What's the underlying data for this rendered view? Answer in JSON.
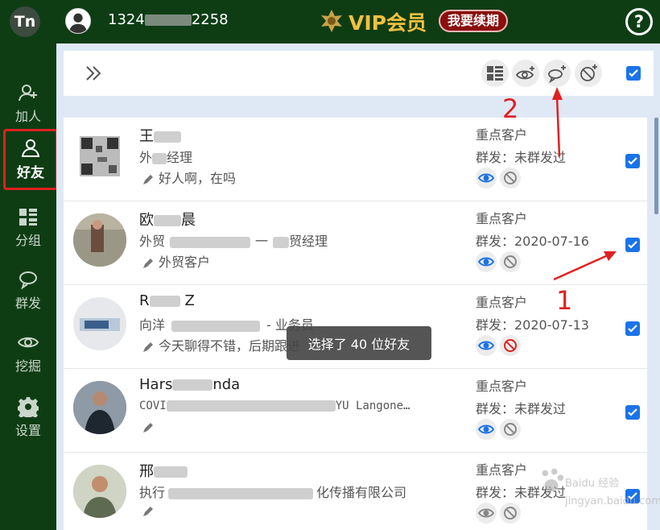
{
  "app": {
    "logo_text": "Tn"
  },
  "sidebar": {
    "items": [
      {
        "label": "加人",
        "icon": "add-user-icon",
        "active": false
      },
      {
        "label": "好友",
        "icon": "friends-icon",
        "active": true
      },
      {
        "label": "分组",
        "icon": "grid-icon",
        "active": false
      },
      {
        "label": "群发",
        "icon": "chat-bubble-icon",
        "active": false
      },
      {
        "label": "挖掘",
        "icon": "eye-icon",
        "active": false
      },
      {
        "label": "设置",
        "icon": "gear-icon",
        "active": false
      }
    ]
  },
  "header": {
    "phone_prefix": "1324",
    "phone_suffix": "2258",
    "vip_label": "VIP会员",
    "renew_label": "我要续期",
    "help_label": "?"
  },
  "toolbar": {
    "icons": [
      "expand-icon",
      "grid-view-icon",
      "add-watch-icon",
      "add-group-send-icon",
      "add-block-icon"
    ],
    "select_all_checked": true
  },
  "friends": [
    {
      "name": "王",
      "title_prefix": "外",
      "title_suffix": "经理",
      "note": "好人啊，在吗",
      "tag": "重点客户",
      "status": "群发：未群发过",
      "checked": true,
      "blocked": false
    },
    {
      "name_prefix": "欧",
      "name_suffix": "晨",
      "title_prefix": "外贸",
      "title_mid": "一",
      "title_suffix": "贸经理",
      "note": "外贸客户",
      "tag": "重点客户",
      "status": "群发：2020-07-16",
      "checked": true,
      "blocked": false
    },
    {
      "name_prefix": "R",
      "name_suffix": "Z",
      "title_prefix": "向洋",
      "title_suffix": "- 业务员",
      "note": "今天聊得不错，后期跟进",
      "tag": "重点客户",
      "status": "群发：2020-07-13",
      "checked": true,
      "blocked": true
    },
    {
      "name_prefix": "Hars",
      "name_suffix": "nda",
      "title_prefix": "COVI",
      "title_suffix": "YU Langone…",
      "note": "",
      "tag": "重点客户",
      "status": "群发：未群发过",
      "checked": true,
      "blocked": false
    },
    {
      "name_prefix": "邢",
      "name_suffix": "",
      "title_prefix": "执行",
      "title_suffix": "化传播有限公司",
      "note": "",
      "tag": "重点客户",
      "status": "群发：未群发过",
      "checked": true,
      "blocked": false
    }
  ],
  "toast": "选择了 40 位好友",
  "annotations": [
    "1",
    "2"
  ],
  "colors": {
    "sidebar_bg": "#0e3d14",
    "accent": "#1a73e8",
    "vip_gold": "#f0c040",
    "annotation": "#e02020"
  },
  "watermark": "Baidu 经验 jingyan.baidu.com"
}
